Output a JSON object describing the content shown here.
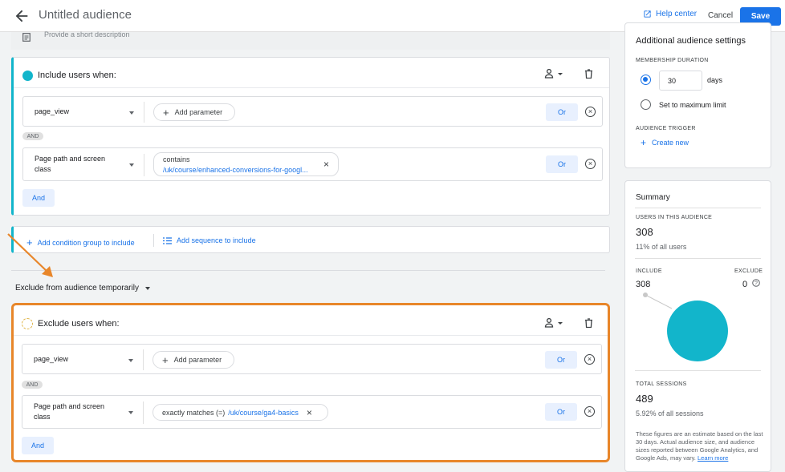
{
  "header": {
    "title": "Untitled audience",
    "help_label": "Help center",
    "cancel_label": "Cancel",
    "save_label": "Save"
  },
  "description": {
    "placeholder": "Provide a short description"
  },
  "include_group": {
    "header": "Include users when:",
    "conditions": [
      {
        "dimension": "page_view",
        "add_parameter": "Add parameter",
        "or_label": "Or"
      },
      {
        "dimension": "Page path and screen class",
        "operator": "contains",
        "value": "/uk/course/enhanced-conversions-for-googl...",
        "or_label": "Or"
      }
    ],
    "and_badge": "AND",
    "and_button": "And"
  },
  "add_actions": {
    "condition_group": "Add condition group to include",
    "sequence": "Add sequence to include"
  },
  "exclude_section": {
    "select_label": "Exclude from audience temporarily",
    "header": "Exclude users when:",
    "conditions": [
      {
        "dimension": "page_view",
        "add_parameter": "Add parameter",
        "or_label": "Or"
      },
      {
        "dimension": "Page path and screen class",
        "operator": "exactly matches (=)",
        "value": "/uk/course/ga4-basics",
        "or_label": "Or"
      }
    ],
    "and_badge": "AND",
    "and_button": "And"
  },
  "settings": {
    "title": "Additional audience settings",
    "membership_duration_caption": "MEMBERSHIP DURATION",
    "duration_value": "30",
    "days_label": "days",
    "max_limit_label": "Set to maximum limit",
    "trigger_caption": "AUDIENCE TRIGGER",
    "create_new_label": "Create new"
  },
  "summary": {
    "title": "Summary",
    "users_caption": "USERS IN THIS AUDIENCE",
    "users_value": "308",
    "users_percent": "11% of all users",
    "include_caption": "INCLUDE",
    "exclude_caption": "EXCLUDE",
    "include_value": "308",
    "exclude_value": "0",
    "sessions_caption": "TOTAL SESSIONS",
    "sessions_value": "489",
    "sessions_percent": "5.92% of all sessions",
    "footnote": "These figures are an estimate based on the last 30 days. Actual audience size, and audience sizes reported between Google Analytics, and Google Ads, may vary.",
    "learn_more": "Learn more",
    "pie_color": "#12b5cb"
  },
  "annotation": {
    "arrow_color": "#e8862a",
    "highlight_color": "#e8862a"
  }
}
